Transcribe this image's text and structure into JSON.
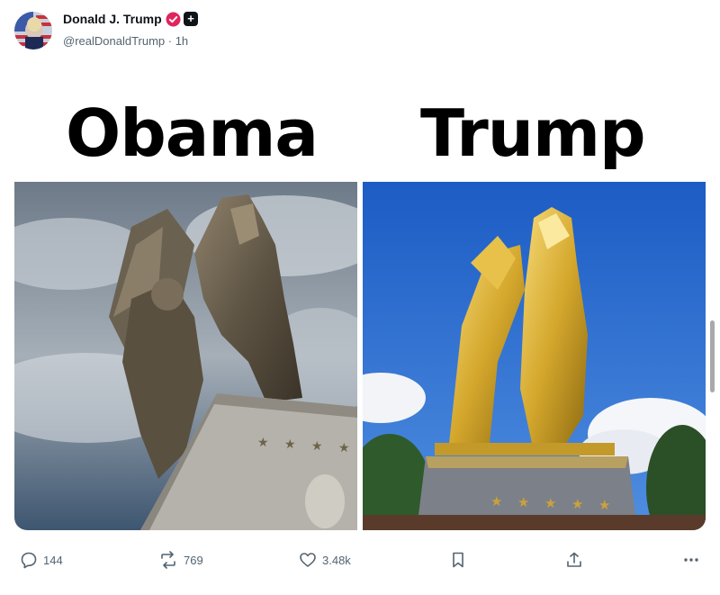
{
  "post": {
    "author_name": "Donald J. Trump",
    "handle_time": "@realDonaldTrump · 1h"
  },
  "image": {
    "left_caption": "Obama",
    "right_caption": "Trump"
  },
  "actions": {
    "replies": "144",
    "reposts": "769",
    "likes": "3.48k"
  },
  "colors": {
    "verified": "#e0245e",
    "text": "#0f1419",
    "muted": "#536471",
    "sky_left": "#8a97a4",
    "sky_right": "#2a6fd0",
    "gold": "#d4a72c"
  },
  "icons": [
    "reply-icon",
    "repost-icon",
    "like-icon",
    "bookmark-icon",
    "share-icon",
    "more-icon"
  ]
}
